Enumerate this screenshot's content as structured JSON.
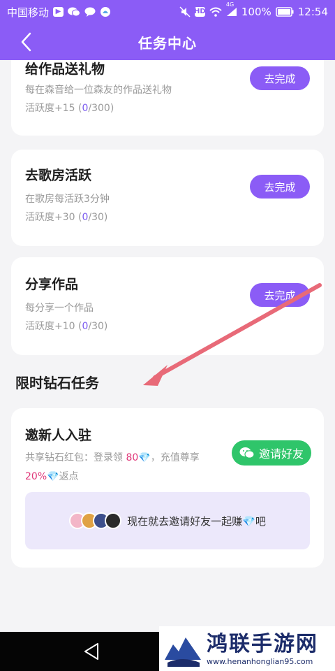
{
  "statusbar": {
    "carrier": "中国移动",
    "battery": "100%",
    "time": "12:54",
    "hd_badge": "HD",
    "net_badge": "4G"
  },
  "header": {
    "title": "任务中心"
  },
  "tasks": [
    {
      "title": "给作品送礼物",
      "desc": "每在森音给一位森友的作品送礼物",
      "progress_prefix": "活跃度+15 (",
      "progress_value": "0",
      "progress_suffix": "/300)",
      "button": "去完成"
    },
    {
      "title": "去歌房活跃",
      "desc": "在歌房每活跃3分钟",
      "progress_prefix": "活跃度+30 (",
      "progress_value": "0",
      "progress_suffix": "/30)",
      "button": "去完成"
    },
    {
      "title": "分享作品",
      "desc": "每分享一个作品",
      "progress_prefix": "活跃度+10 (",
      "progress_value": "0",
      "progress_suffix": "/30)",
      "button": "去完成"
    }
  ],
  "diamond_section": {
    "title": "限时钻石任务",
    "task": {
      "title": "邀新人入驻",
      "desc_part1": "共享钻石红包：登录领 ",
      "desc_value1": "80",
      "desc_part2": "，充值尊享",
      "desc_value2": "20%",
      "desc_part3": "返点",
      "gem_glyph": "💎",
      "button": "邀请好友"
    },
    "banner": {
      "text_before": "现在就去邀请好友一起赚",
      "text_after": "吧"
    }
  },
  "watermark": {
    "name": "鸿联手游网",
    "url": "www.henanhonglian95.com"
  },
  "colors": {
    "brand": "#8b5cf6",
    "green": "#2fc56a",
    "pink": "#e0387a",
    "arrow": "#e86a78"
  },
  "icons": [
    "back-chevron-icon",
    "wechat-icon",
    "diamond-icon",
    "wifi-icon",
    "battery-icon",
    "nav-back-icon"
  ]
}
